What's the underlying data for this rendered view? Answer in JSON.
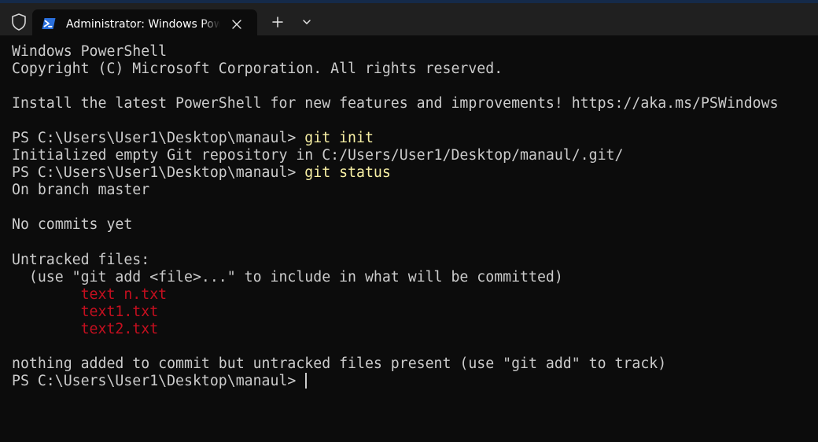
{
  "window": {
    "tab_title": "Administrator: Windows PowerShell"
  },
  "colors": {
    "background": "#0c0c0c",
    "titlebar": "#202020",
    "text": "#cccccc",
    "command": "#f9f1a5",
    "untracked_file": "#c50f1f"
  },
  "icons": {
    "shield": "shield-icon",
    "powershell": "powershell-icon",
    "close": "close-icon",
    "new_tab": "plus-icon",
    "dropdown": "chevron-down-icon"
  },
  "terminal": {
    "lines": [
      {
        "text": "Windows PowerShell"
      },
      {
        "text": "Copyright (C) Microsoft Corporation. All rights reserved."
      },
      {
        "text": ""
      },
      {
        "text": "Install the latest PowerShell for new features and improvements! https://aka.ms/PSWindows"
      },
      {
        "text": ""
      },
      {
        "prompt": "PS C:\\Users\\User1\\Desktop\\manaul> ",
        "command": "git init"
      },
      {
        "text": "Initialized empty Git repository in C:/Users/User1/Desktop/manaul/.git/"
      },
      {
        "prompt": "PS C:\\Users\\User1\\Desktop\\manaul> ",
        "command": "git status"
      },
      {
        "text": "On branch master"
      },
      {
        "text": ""
      },
      {
        "text": "No commits yet"
      },
      {
        "text": ""
      },
      {
        "text": "Untracked files:"
      },
      {
        "text": "  (use \"git add <file>...\" to include in what will be committed)"
      },
      {
        "indent": "        ",
        "file": "text n.txt"
      },
      {
        "indent": "        ",
        "file": "text1.txt"
      },
      {
        "indent": "        ",
        "file": "text2.txt"
      },
      {
        "text": ""
      },
      {
        "text": "nothing added to commit but untracked files present (use \"git add\" to track)"
      },
      {
        "prompt": "PS C:\\Users\\User1\\Desktop\\manaul> ",
        "cursor": true
      }
    ]
  }
}
